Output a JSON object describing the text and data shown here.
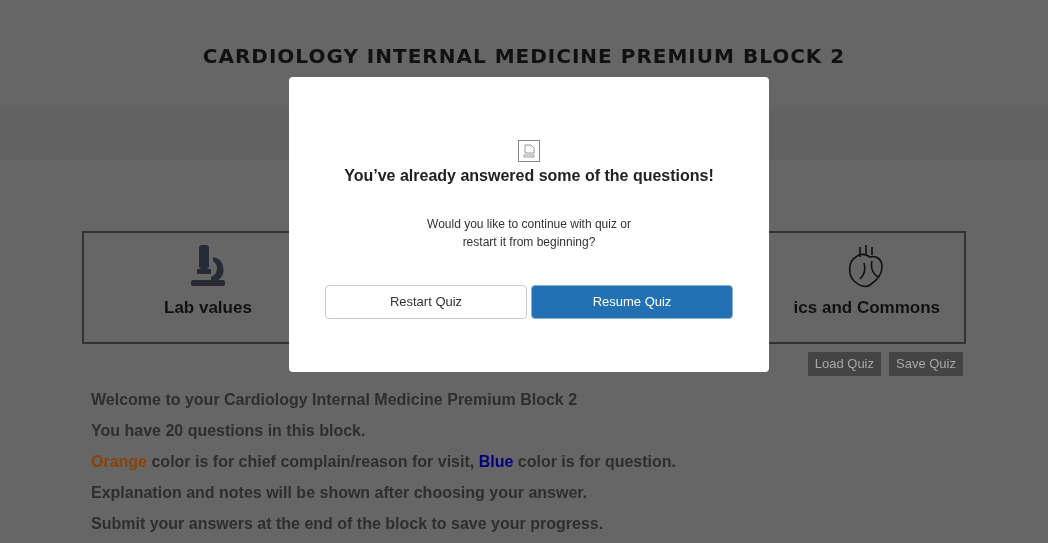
{
  "page": {
    "title": "CARDIOLOGY INTERNAL MEDICINE PREMIUM BLOCK 2",
    "cards": [
      {
        "kind": "microscope",
        "label": "Lab values"
      },
      {
        "kind": "heart",
        "label": "ics and Commons"
      }
    ],
    "buttons": [
      "Load Quiz",
      "Save Quiz"
    ],
    "intro": [
      [
        {
          "text": "Welcome to your Cardiology Internal Medicine Premium Block 2"
        }
      ],
      [
        {
          "text": "You have 20 questions in this block."
        }
      ],
      [
        {
          "text": "Orange",
          "color": "#8a4306"
        },
        {
          "text": " color is for chief complain/reason for visit, "
        },
        {
          "text": "Blue",
          "color": "#00007a"
        },
        {
          "text": " color is for question."
        }
      ],
      [
        {
          "text": "Explanation and notes will be shown after choosing your answer."
        }
      ],
      [
        {
          "text": "Submit your answers at the end of the block to save your progress."
        }
      ]
    ]
  },
  "dialog": {
    "title": "You’ve already answered some of the questions!",
    "message_lines": [
      "Would you like to continue with quiz or",
      "restart it from beginning?"
    ],
    "buttons": [
      {
        "label": "Restart Quiz",
        "kind": "secondary"
      },
      {
        "label": "Resume Quiz",
        "kind": "primary"
      }
    ]
  }
}
